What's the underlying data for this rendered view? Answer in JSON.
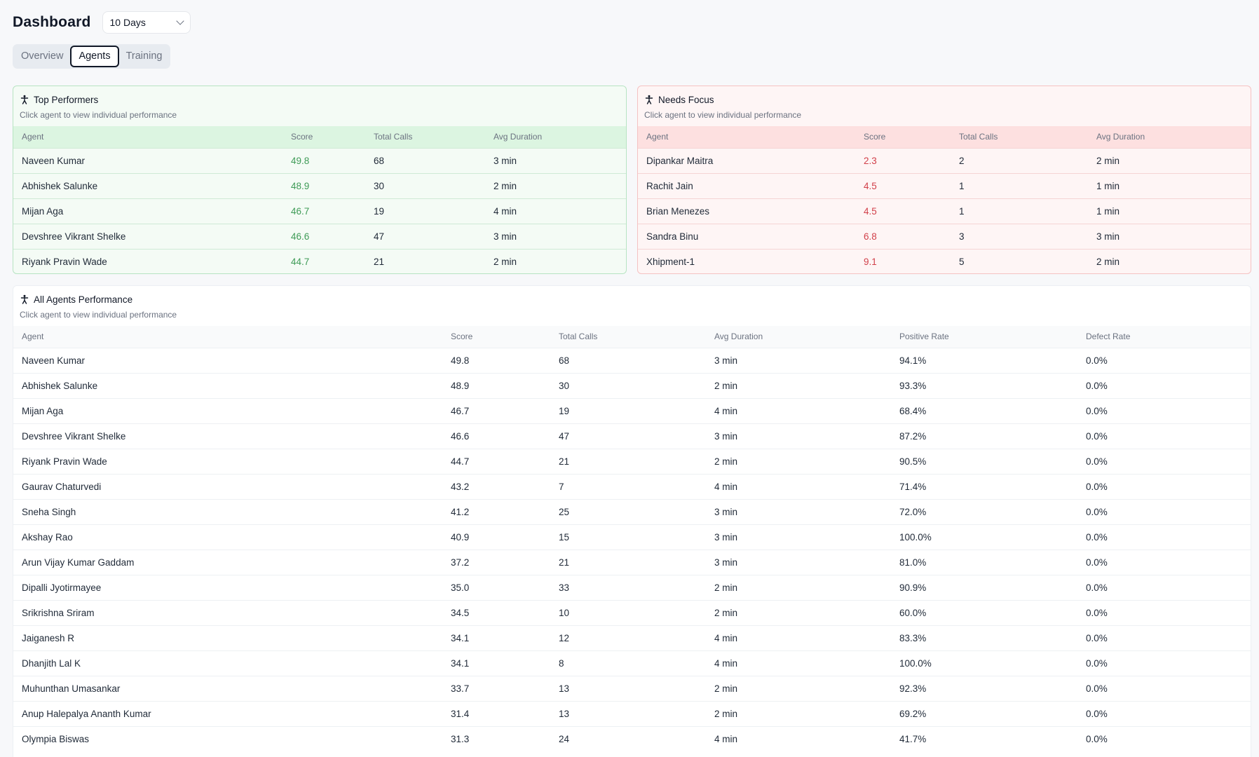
{
  "header": {
    "title": "Dashboard",
    "range": "10 Days"
  },
  "tabs": [
    {
      "label": "Overview",
      "active": false
    },
    {
      "label": "Agents",
      "active": true
    },
    {
      "label": "Training",
      "active": false
    }
  ],
  "colors": {
    "good": "#3f9b57",
    "bad": "#d1404a"
  },
  "top_performers": {
    "title": "Top Performers",
    "subtitle": "Click agent to view individual performance",
    "columns": [
      "Agent",
      "Score",
      "Total Calls",
      "Avg Duration"
    ],
    "rows": [
      [
        "Naveen Kumar",
        "49.8",
        "68",
        "3 min"
      ],
      [
        "Abhishek Salunke",
        "48.9",
        "30",
        "2 min"
      ],
      [
        "Mijan Aga",
        "46.7",
        "19",
        "4 min"
      ],
      [
        "Devshree Vikrant Shelke",
        "46.6",
        "47",
        "3 min"
      ],
      [
        "Riyank Pravin Wade",
        "44.7",
        "21",
        "2 min"
      ]
    ]
  },
  "needs_focus": {
    "title": "Needs Focus",
    "subtitle": "Click agent to view individual performance",
    "columns": [
      "Agent",
      "Score",
      "Total Calls",
      "Avg Duration"
    ],
    "rows": [
      [
        "Dipankar Maitra",
        "2.3",
        "2",
        "2 min"
      ],
      [
        "Rachit Jain",
        "4.5",
        "1",
        "1 min"
      ],
      [
        "Brian Menezes",
        "4.5",
        "1",
        "1 min"
      ],
      [
        "Sandra Binu",
        "6.8",
        "3",
        "3 min"
      ],
      [
        "Xhipment-1",
        "9.1",
        "5",
        "2 min"
      ]
    ]
  },
  "all_agents": {
    "title": "All Agents Performance",
    "subtitle": "Click agent to view individual performance",
    "columns": [
      "Agent",
      "Score",
      "Total Calls",
      "Avg Duration",
      "Positive Rate",
      "Defect Rate"
    ],
    "rows": [
      [
        "Naveen Kumar",
        "49.8",
        "68",
        "3 min",
        "94.1%",
        "0.0%"
      ],
      [
        "Abhishek Salunke",
        "48.9",
        "30",
        "2 min",
        "93.3%",
        "0.0%"
      ],
      [
        "Mijan Aga",
        "46.7",
        "19",
        "4 min",
        "68.4%",
        "0.0%"
      ],
      [
        "Devshree Vikrant Shelke",
        "46.6",
        "47",
        "3 min",
        "87.2%",
        "0.0%"
      ],
      [
        "Riyank Pravin Wade",
        "44.7",
        "21",
        "2 min",
        "90.5%",
        "0.0%"
      ],
      [
        "Gaurav Chaturvedi",
        "43.2",
        "7",
        "4 min",
        "71.4%",
        "0.0%"
      ],
      [
        "Sneha Singh",
        "41.2",
        "25",
        "3 min",
        "72.0%",
        "0.0%"
      ],
      [
        "Akshay Rao",
        "40.9",
        "15",
        "3 min",
        "100.0%",
        "0.0%"
      ],
      [
        "Arun Vijay Kumar Gaddam",
        "37.2",
        "21",
        "3 min",
        "81.0%",
        "0.0%"
      ],
      [
        "Dipalli Jyotirmayee",
        "35.0",
        "33",
        "2 min",
        "90.9%",
        "0.0%"
      ],
      [
        "Srikrishna Sriram",
        "34.5",
        "10",
        "2 min",
        "60.0%",
        "0.0%"
      ],
      [
        "Jaiganesh R",
        "34.1",
        "12",
        "4 min",
        "83.3%",
        "0.0%"
      ],
      [
        "Dhanjith Lal K",
        "34.1",
        "8",
        "4 min",
        "100.0%",
        "0.0%"
      ],
      [
        "Muhunthan Umasankar",
        "33.7",
        "13",
        "2 min",
        "92.3%",
        "0.0%"
      ],
      [
        "Anup Halepalya Ananth Kumar",
        "31.4",
        "13",
        "2 min",
        "69.2%",
        "0.0%"
      ],
      [
        "Olympia Biswas",
        "31.3",
        "24",
        "4 min",
        "41.7%",
        "0.0%"
      ]
    ]
  }
}
